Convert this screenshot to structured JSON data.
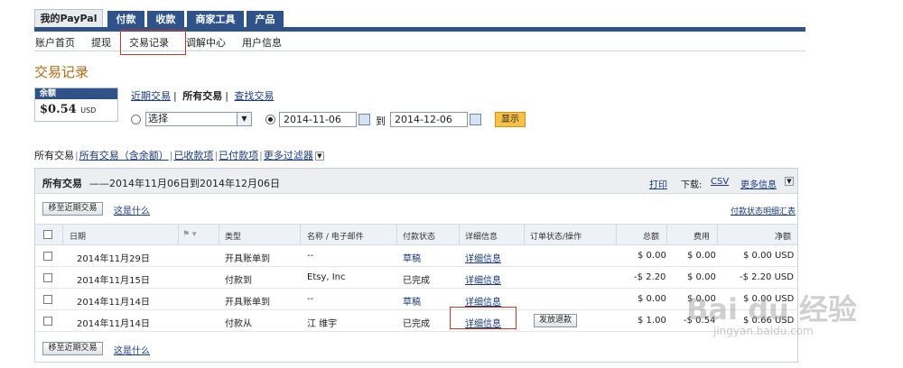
{
  "tabs": [
    {
      "label": "我的PayPal",
      "active": true
    },
    {
      "label": "付款",
      "active": false
    },
    {
      "label": "收款",
      "active": false
    },
    {
      "label": "商家工具",
      "active": false
    },
    {
      "label": "产品",
      "active": false
    }
  ],
  "subnav": [
    "账户首页",
    "提现",
    "交易记录",
    "调解中心",
    "用户信息"
  ],
  "page_title": "交易记录",
  "balance": {
    "label": "余额",
    "amount": "$0.54",
    "currency": "USD"
  },
  "views": {
    "recent": "近期交易",
    "sep1": "|",
    "all": "所有交易",
    "sep2": "|",
    "find": "查找交易"
  },
  "filter": {
    "select_value": "选择",
    "date_from": "2014-11-06",
    "to_label": "到",
    "date_to": "2014-12-06",
    "show_button": "显示"
  },
  "subfilters": [
    "所有交易",
    "所有交易（含余额）",
    "已收款项",
    "已付款项",
    "更多过滤器"
  ],
  "panel": {
    "heading": "所有交易",
    "range": "——2014年11月06日到2014年12月06日",
    "print": "打印",
    "download_label": "下载:",
    "csv": "CSV",
    "more_info": "更多信息",
    "archive_button": "移至近期交易",
    "what_is_this": "这是什么",
    "status_summary": "付款状态明细汇表"
  },
  "columns": [
    "日期",
    "类型",
    "名称 / 电子邮件",
    "付款状态",
    "详细信息",
    "订单状态/操作",
    "总额",
    "费用",
    "净额"
  ],
  "rows": [
    {
      "date": "2014年11月29日",
      "type": "开具账单到",
      "name": "--",
      "status": "草稿",
      "details": "详细信息",
      "action": "",
      "gross": "$ 0.00",
      "fee": "$ 0.00",
      "net": "$ 0.00 USD"
    },
    {
      "date": "2014年11月15日",
      "type": "付款到",
      "name": "Etsy, Inc",
      "status": "已完成",
      "details": "详细信息",
      "action": "",
      "gross": "-$ 2.20",
      "fee": "$ 0.00",
      "net": "-$ 2.20 USD"
    },
    {
      "date": "2014年11月14日",
      "type": "开具账单到",
      "name": "--",
      "status": "草稿",
      "details": "详细信息",
      "action": "",
      "gross": "$ 0.00",
      "fee": "$ 0.00",
      "net": "$ 0.00 USD"
    },
    {
      "date": "2014年11月14日",
      "type": "付款从",
      "name": "江 维宇",
      "status": "已完成",
      "details": "详细信息",
      "action": "发放退款",
      "gross": "$ 1.00",
      "fee": "-$ 0.54",
      "net": "$ 0.66 USD"
    }
  ],
  "watermark": {
    "logo": "Bai du 经验",
    "url": "jingyan.baidu.com"
  },
  "colors": {
    "tab_blue": "#2f5389",
    "title_orange": "#b06a14",
    "show_button": "#f5c146",
    "highlight_red": "#c0392b"
  }
}
